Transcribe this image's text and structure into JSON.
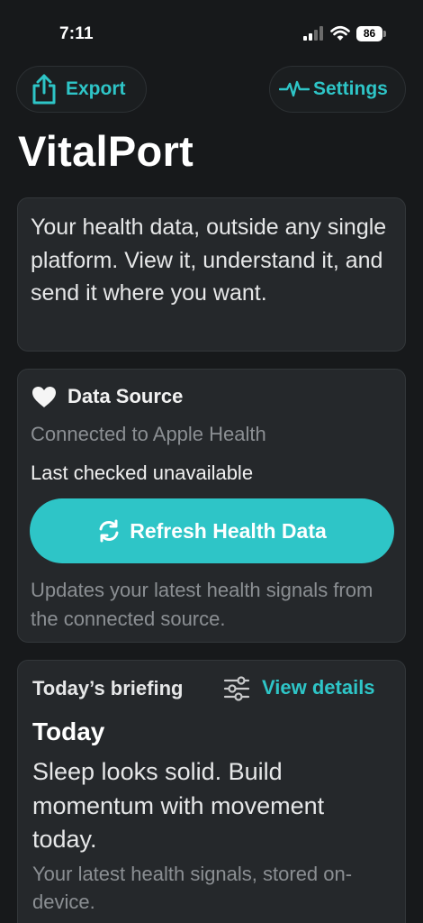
{
  "status_bar": {
    "time": "7:11",
    "battery": "86"
  },
  "header": {
    "export_label": "Export",
    "settings_label": "Settings"
  },
  "app": {
    "title": "VitalPort"
  },
  "intro": {
    "text": "Your health data, outside any single platform. View it, understand it, and send it where you want."
  },
  "data_source": {
    "title": "Data Source",
    "connected": "Connected to Apple Health",
    "last_checked": "Last checked unavailable",
    "refresh_label": "Refresh Health Data",
    "note": "Updates your latest health signals from the connected source."
  },
  "briefing": {
    "label": "Today’s briefing",
    "view_details": "View details",
    "title": "Today",
    "text": "Sleep looks solid. Build momentum with movement today.",
    "sub": "Your latest health signals, stored on-device."
  },
  "colors": {
    "accent": "#2ec5c7",
    "background": "#17191b",
    "card": "#25282b"
  }
}
